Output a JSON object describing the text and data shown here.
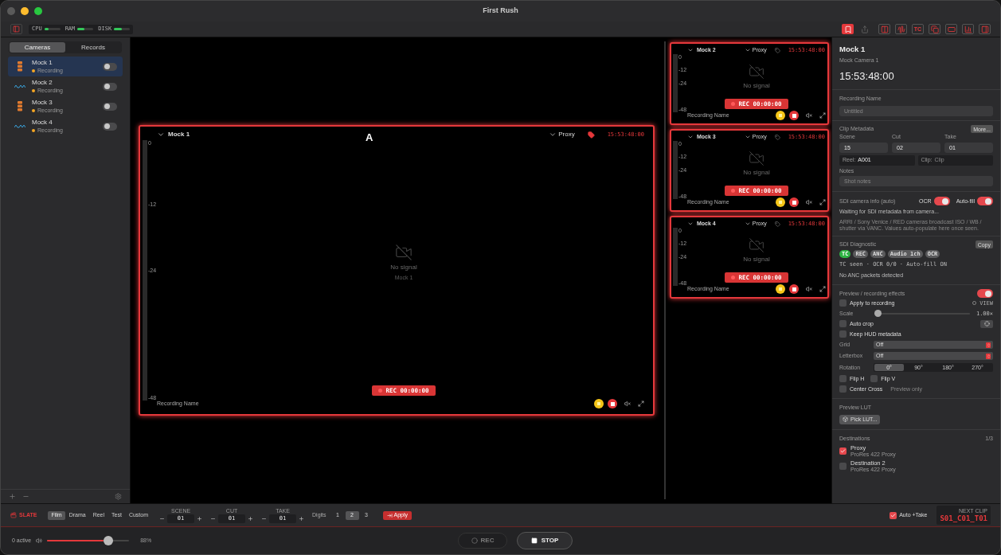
{
  "window": {
    "title": "First Rush"
  },
  "toolbar": {
    "meters": [
      {
        "label": "CPU",
        "level": 0.25
      },
      {
        "label": "RAM",
        "level": 0.45
      },
      {
        "label": "DISK",
        "level": 0.5
      }
    ],
    "tools": [
      {
        "kind": "bookmark",
        "on": true
      },
      {
        "kind": "share",
        "on": false
      },
      {
        "kind": "columns",
        "on": true
      },
      {
        "kind": "waveform",
        "on": true
      },
      {
        "kind": "text",
        "label": "TC",
        "on": true
      },
      {
        "kind": "copy",
        "on": true
      },
      {
        "kind": "frame",
        "on": true
      },
      {
        "kind": "bars",
        "on": true
      },
      {
        "kind": "panel",
        "on": true
      }
    ]
  },
  "sidebar": {
    "tabs": [
      {
        "label": "Cameras",
        "selected": true
      },
      {
        "label": "Records",
        "selected": false
      }
    ],
    "cameras": [
      {
        "name": "Mock 1",
        "status": "Recording",
        "color": "#f5a623",
        "kind": "stack",
        "selected": true,
        "on": false
      },
      {
        "name": "Mock 2",
        "status": "Recording",
        "color": "#f5a623",
        "kind": "wave",
        "selected": false,
        "on": false
      },
      {
        "name": "Mock 3",
        "status": "Recording",
        "color": "#f5a623",
        "kind": "stack",
        "selected": false,
        "on": false
      },
      {
        "name": "Mock 4",
        "status": "Recording",
        "color": "#f5a623",
        "kind": "wave",
        "selected": false,
        "on": false
      }
    ]
  },
  "main_viewer": {
    "name": "Mock 1",
    "letter": "A",
    "output": "Proxy",
    "timecode": "15:53:48:00",
    "signal": "No signal",
    "source": "Mock 1",
    "rec": "REC 00:00:00",
    "recording_name": "Recording Name",
    "meter_ticks": [
      "0",
      "-12",
      "-24",
      "-48"
    ]
  },
  "thumbnails": [
    {
      "name": "Mock 2",
      "output": "Proxy",
      "timecode": "15:53:48:00",
      "signal": "No signal",
      "rec": "REC 00:00:00",
      "recording_name": "Recording Name",
      "meter_ticks": [
        "0",
        "-12",
        "-24",
        "-48"
      ]
    },
    {
      "name": "Mock 3",
      "output": "Proxy",
      "timecode": "15:53:48:00",
      "signal": "No signal",
      "rec": "REC 00:00:00",
      "recording_name": "Recording Name",
      "meter_ticks": [
        "0",
        "-12",
        "-24",
        "-48"
      ]
    },
    {
      "name": "Mock 4",
      "output": "Proxy",
      "timecode": "15:53:48:00",
      "signal": "No signal",
      "rec": "REC 00:00:00",
      "recording_name": "Recording Name",
      "meter_ticks": [
        "0",
        "-12",
        "-24",
        "-48"
      ]
    }
  ],
  "inspector": {
    "title": "Mock 1",
    "subtitle": "Mock Camera 1",
    "timecode": "15:53:48:00",
    "recording_name": {
      "label": "Recording Name",
      "placeholder": "Untitled"
    },
    "clip_metadata": {
      "title": "Clip Metadata",
      "more": "More...",
      "fields": [
        {
          "label": "Scene",
          "value": "15"
        },
        {
          "label": "Cut",
          "value": "02"
        },
        {
          "label": "Take",
          "value": "01"
        }
      ],
      "reel": {
        "label": "Reel:",
        "value": "A001"
      },
      "clip": {
        "label": "Clip:",
        "placeholder": "Clip"
      },
      "notes": {
        "label": "Notes",
        "placeholder": "Shot notes"
      }
    },
    "sdi_info": {
      "title": "SDI camera info (auto)",
      "toggles": [
        {
          "label": "OCR",
          "on": true
        },
        {
          "label": "Auto-fill",
          "on": true
        }
      ],
      "status": "Waiting for SDI metadata from camera...",
      "hint": "ARRI / Sony Venice / RED cameras broadcast ISO / WB / shutter via VANC. Values auto-populate here once seen."
    },
    "sdi_diagnostic": {
      "title": "SDI Diagnostic",
      "copy": "Copy",
      "pills": [
        {
          "label": "TC",
          "on": true
        },
        {
          "label": "REC",
          "on": false
        },
        {
          "label": "ANC",
          "on": false
        },
        {
          "label": "Audio 1ch",
          "on": false
        },
        {
          "label": "OCR",
          "on": false
        }
      ],
      "summary": "TC seen · OCR 0/0 · Auto-fill ON",
      "detail": "No ANC packets detected"
    },
    "effects": {
      "title": "Preview / recording effects",
      "on": true,
      "apply": {
        "label": "Apply to recording",
        "checked": false
      },
      "view": {
        "label": "VIEW",
        "selected": false
      },
      "scale": {
        "label": "Scale",
        "level": 0,
        "reading": "1.00×"
      },
      "auto_crop": {
        "label": "Auto crop",
        "checked": false
      },
      "keep_hud": {
        "label": "Keep HUD metadata",
        "checked": false
      },
      "selects": [
        {
          "label": "Grid",
          "value": "Off"
        },
        {
          "label": "Letterbox",
          "value": "Off"
        }
      ],
      "rotation": {
        "label": "Rotation",
        "options": [
          {
            "label": "0°",
            "selected": true
          },
          {
            "label": "90°",
            "selected": false
          },
          {
            "label": "180°",
            "selected": false
          },
          {
            "label": "270°",
            "selected": false
          }
        ]
      },
      "flips": [
        {
          "label": "Flip H",
          "checked": false
        },
        {
          "label": "Flip V",
          "checked": false
        }
      ],
      "center_cross": {
        "label": "Center Cross",
        "checked": false,
        "note": "Preview only"
      }
    },
    "lut": {
      "title": "Preview LUT",
      "button": "Pick LUT..."
    },
    "destinations": {
      "title": "Destinations",
      "count": "1/3",
      "items": [
        {
          "name": "Proxy",
          "format": "ProRes 422 Proxy",
          "checked": true
        },
        {
          "name": "Destination 2",
          "format": "ProRes 422 Proxy",
          "checked": false
        }
      ]
    }
  },
  "slate": {
    "label": "SLATE",
    "modes": [
      {
        "label": "Film",
        "selected": true
      },
      {
        "label": "Drama",
        "selected": false
      },
      {
        "label": "Reel",
        "selected": false
      },
      {
        "label": "Test",
        "selected": false
      },
      {
        "label": "Custom",
        "selected": false
      }
    ],
    "counters": [
      {
        "label": "SCENE",
        "value": "01"
      },
      {
        "label": "CUT",
        "value": "01"
      },
      {
        "label": "TAKE",
        "value": "01"
      }
    ],
    "digits": {
      "label": "Digits",
      "options": [
        {
          "label": "1",
          "selected": false
        },
        {
          "label": "2",
          "selected": true
        },
        {
          "label": "3",
          "selected": false
        }
      ]
    },
    "apply": "Apply",
    "auto_take": {
      "label": "Auto +Take",
      "checked": true
    },
    "next_clip": {
      "label": "NEXT CLIP",
      "value": "S01_C01_T01"
    }
  },
  "transport": {
    "active": "0 active",
    "volume": {
      "level": 0.78,
      "reading": "88%"
    },
    "rec": {
      "label": "REC",
      "disabled": true
    },
    "stop": {
      "label": "STOP"
    }
  }
}
